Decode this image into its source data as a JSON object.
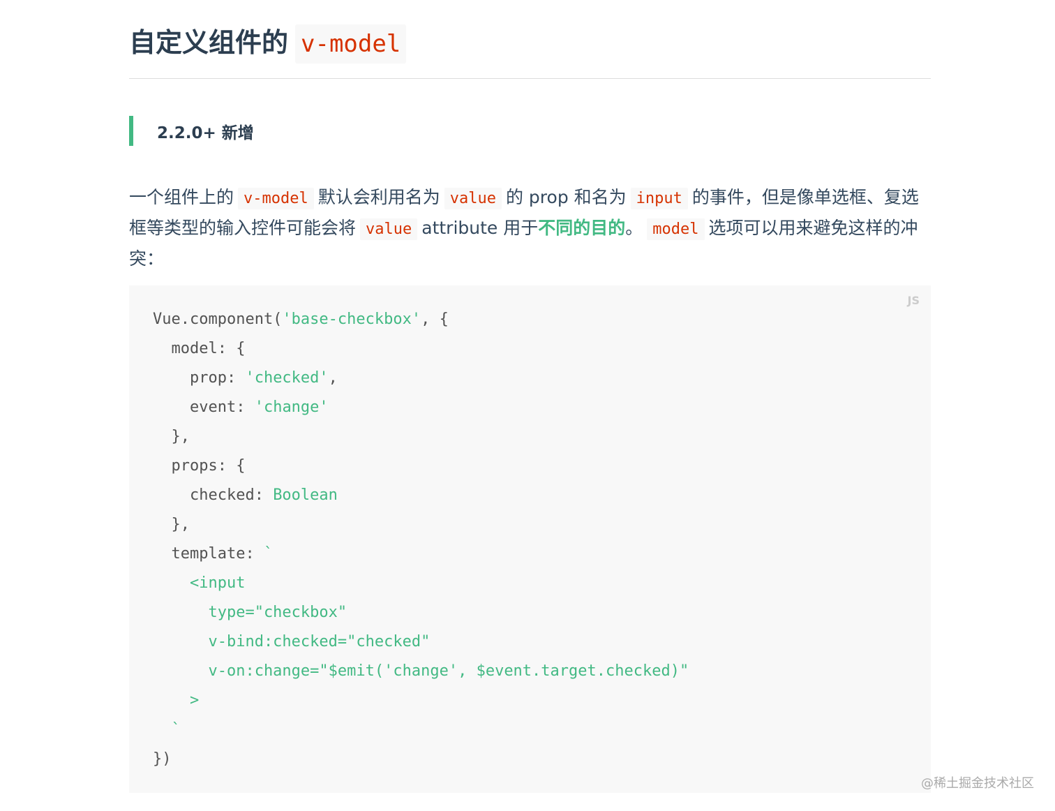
{
  "header": {
    "title": "自定义组件的",
    "title_code": "v-model"
  },
  "badge": {
    "text": "2.2.0+ 新增"
  },
  "intro": {
    "part1": "一个组件上的",
    "code1": "v-model",
    "part2": "默认会利用名为",
    "code2": "value",
    "part3": "的 prop 和名为",
    "code3": "input",
    "part4": "的事件，但是像单选框、复选框等类型的输入控件可能会将",
    "code4": "value",
    "part5": "attribute 用于",
    "strong": "不同的目的",
    "part6": "。",
    "code5": "model",
    "part7": "选项可以用来避免这样的冲突："
  },
  "code_block": {
    "language": "JS",
    "lines": [
      [
        {
          "t": "Vue.component(",
          "c": "plain"
        },
        {
          "t": "'base-checkbox'",
          "c": "str"
        },
        {
          "t": ", {",
          "c": "plain"
        }
      ],
      [
        {
          "t": "  model: {",
          "c": "plain"
        }
      ],
      [
        {
          "t": "    prop: ",
          "c": "plain"
        },
        {
          "t": "'checked'",
          "c": "str"
        },
        {
          "t": ",",
          "c": "plain"
        }
      ],
      [
        {
          "t": "    event: ",
          "c": "plain"
        },
        {
          "t": "'change'",
          "c": "str"
        }
      ],
      [
        {
          "t": "  },",
          "c": "plain"
        }
      ],
      [
        {
          "t": "  props: {",
          "c": "plain"
        }
      ],
      [
        {
          "t": "    checked: ",
          "c": "plain"
        },
        {
          "t": "Boolean",
          "c": "type"
        }
      ],
      [
        {
          "t": "  },",
          "c": "plain"
        }
      ],
      [
        {
          "t": "  template: ",
          "c": "plain"
        },
        {
          "t": "`",
          "c": "str"
        }
      ],
      [
        {
          "t": "    <input",
          "c": "str"
        }
      ],
      [
        {
          "t": "      type=\"checkbox\"",
          "c": "str"
        }
      ],
      [
        {
          "t": "      v-bind:checked=\"checked\"",
          "c": "str"
        }
      ],
      [
        {
          "t": "      v-on:change=\"$emit('change', $event.target.checked)\"",
          "c": "str"
        }
      ],
      [
        {
          "t": "    >",
          "c": "str"
        }
      ],
      [
        {
          "t": "  `",
          "c": "str"
        }
      ],
      [
        {
          "t": "})",
          "c": "plain"
        }
      ]
    ]
  },
  "watermark": {
    "text": "@稀土掘金技术社区"
  },
  "colors": {
    "accent": "#42b983",
    "inline_code": "#d63200",
    "text": "#34495e",
    "code_bg": "#f8f8f8"
  }
}
